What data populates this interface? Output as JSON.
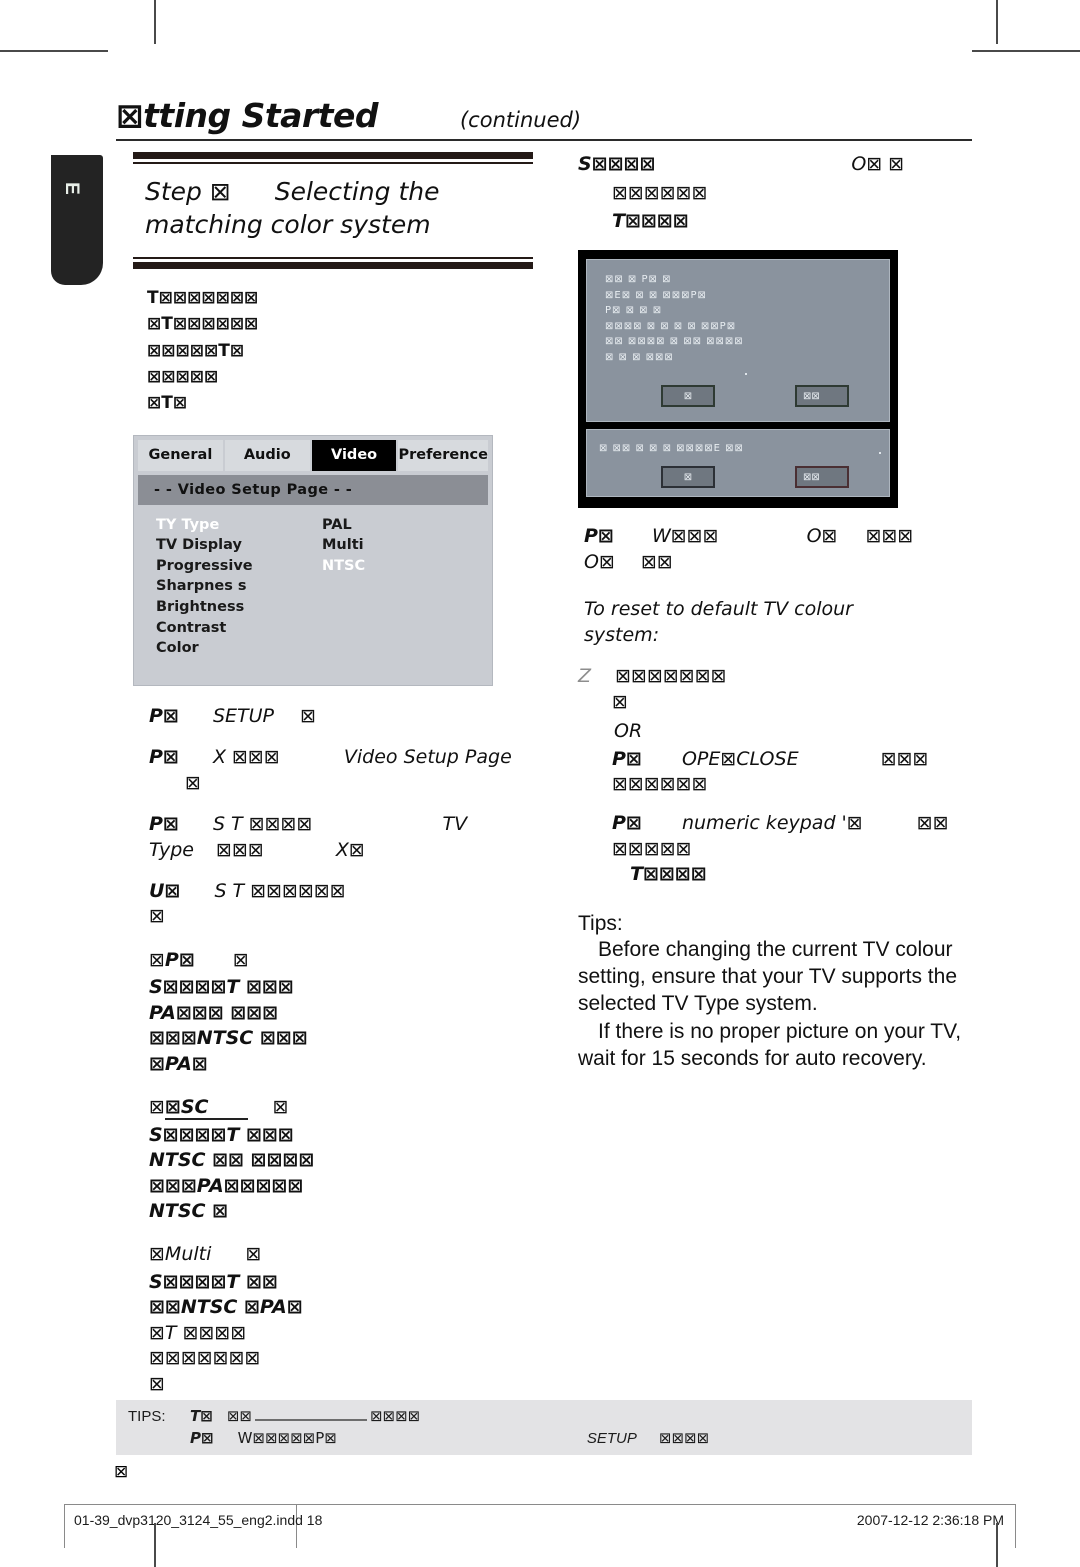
{
  "page": {
    "side_tab_glyph": "E",
    "header": {
      "title": "⊠tting Started",
      "continued": "(continued)"
    },
    "step_heading": {
      "line1_pre": "Step",
      "line1_num": "⊠",
      "line1_post": "Selecting the",
      "line2": "matching color system"
    },
    "intro_lines": [
      "T⊠⊠⊠⊠⊠⊠⊠",
      "⊠T⊠⊠⊠⊠⊠⊠",
      "⊠⊠⊠⊠⊠T⊠",
      "⊠⊠⊠⊠⊠",
      "⊠T⊠"
    ],
    "osd": {
      "tabs": [
        {
          "label": "General",
          "selected": false
        },
        {
          "label": "Audio",
          "selected": false
        },
        {
          "label": "Video",
          "selected": true
        },
        {
          "label": "Preference",
          "selected": false
        }
      ],
      "page_title": "- -  Video Setup Page  - -",
      "items": [
        {
          "label": "TY Type",
          "highlight": true
        },
        {
          "label": "TV Display",
          "highlight": false
        },
        {
          "label": "Progressive",
          "highlight": false
        },
        {
          "label": "Sharpnes s",
          "highlight": false
        },
        {
          "label": "Brightness",
          "highlight": false
        },
        {
          "label": "Contrast",
          "highlight": false
        },
        {
          "label": "Color",
          "highlight": false
        }
      ],
      "values": [
        {
          "label": "PAL",
          "highlight": false
        },
        {
          "label": "Multi",
          "highlight": false
        },
        {
          "label": "NTSC",
          "highlight": true
        }
      ]
    },
    "steps": [
      {
        "a": "P⊠",
        "b": "SETUP",
        "c": "⊠"
      },
      {
        "a": "P⊠",
        "b": "X ⊠⊠⊠",
        "c": "Video Setup Page",
        "d": "⊠"
      },
      {
        "a": "P⊠",
        "b": "S T ⊠⊠⊠⊠",
        "c": "TV",
        "d": "Type",
        "e": "⊠⊠⊠",
        "f": "X⊠"
      },
      {
        "a": "U⊠",
        "b": "S T ⊠⊠⊠⊠⊠⊠",
        "c": "⊠"
      }
    ],
    "options": [
      {
        "head_pre": "⊠",
        "head_b": "P⊠",
        "head_post": "⊠",
        "lines": [
          "S⊠⊠⊠⊠T ⊠⊠⊠",
          "PA⊠⊠⊠ ⊠⊠⊠",
          "⊠⊠⊠NTSC ⊠⊠⊠",
          "⊠PA⊠"
        ],
        "underline": false
      },
      {
        "head_pre": "⊠",
        "head_b": "⊠SC",
        "head_post": "⊠",
        "lines": [
          "S⊠⊠⊠⊠T ⊠⊠⊠",
          "NTSC ⊠⊠ ⊠⊠⊠⊠",
          "⊠⊠⊠PA⊠⊠⊠⊠⊠",
          "NTSC ⊠"
        ],
        "underline": true
      },
      {
        "head_pre": "⊠",
        "head_b": "Multi",
        "head_post": "⊠",
        "lines": [
          "S⊠⊠⊠⊠T ⊠⊠",
          "⊠⊠NTSC ⊠PA⊠",
          "⊠T ⊠⊠⊠⊠",
          "⊠⊠⊠⊠⊠⊠⊠",
          "⊠"
        ],
        "underline": false
      }
    ],
    "right": {
      "lead": {
        "a": "S⊠⊠⊠⊠",
        "b": "O⊠ ⊠",
        "c": "⊠⊠⊠⊠⊠⊠",
        "d": "T⊠⊠⊠⊠"
      },
      "tv": {
        "panel_a_lines": [
          "⊠⊠                      ⊠    P⊠ ⊠",
          "⊠E⊠ ⊠               ⊠    ⊠⊠⊠P⊠",
          "    P⊠ ⊠  ⊠   ⊠",
          "⊠⊠⊠⊠ ⊠                ⊠  ⊠    ⊠    ⊠⊠P⊠",
          "     ⊠⊠        ⊠⊠⊠⊠ ⊠                  ⊠⊠  ⊠⊠⊠⊠",
          "     ⊠      ⊠    ⊠     ⊠⊠⊠"
        ],
        "panel_a_ok": "⊠",
        "panel_a_cancel": "⊠⊠",
        "panel_b_line": "⊠            ⊠⊠   ⊠        ⊠      ⊠ ⊠⊠⊠⊠E ⊠⊠",
        "panel_b_ok": "⊠",
        "panel_b_cancel": "⊠⊠"
      },
      "press_wait": {
        "a": "P⊠",
        "b": "W⊠⊠⊠",
        "c": "O⊠",
        "d": "⊠⊠⊠",
        "e": "O⊠",
        "f": "⊠⊠"
      },
      "reset_note": "To reset to default TV colour\nsystem:",
      "reset_steps": {
        "z_mark": "Z",
        "z_text": "⊠⊠⊠⊠⊠⊠⊠",
        "z_sub": "⊠",
        "or": "OR",
        "open_a": "P⊠",
        "open_b": "OPE⊠CLOSE",
        "open_c": "⊠⊠⊠",
        "open_d": "⊠⊠⊠⊠⊠⊠",
        "num_a": "P⊠",
        "num_b": "numeric keypad '⊠",
        "num_c": "⊠⊠",
        "num_d": "⊠⊠⊠⊠⊠",
        "num_e": "T⊠⊠⊠⊠"
      },
      "tips": {
        "head": "Tips:",
        "l1": "Before changing the current TV colour",
        "l2": "setting, ensure that your TV supports the",
        "l3": " selected TV Type  system.",
        "l4": "If there is no proper picture on your TV,",
        "l5": "wait for 15 seconds for auto recovery."
      }
    },
    "tips_bar": {
      "label": "TIPS:",
      "row1_a": "T⊠",
      "row1_b": "⊠⊠",
      "row1_c": "⊠⊠⊠⊠",
      "row2_a": "P⊠",
      "row2_b": "W⊠⊠⊠⊠⊠P⊠",
      "row2_c": "SETUP",
      "row2_d": "⊠⊠⊠⊠"
    },
    "stray_glyph": "⊠",
    "footer": {
      "filename": "01-39_dvp3120_3124_55_eng2.indd   18",
      "timestamp": "2007-12-12   2:36:18 PM"
    }
  }
}
